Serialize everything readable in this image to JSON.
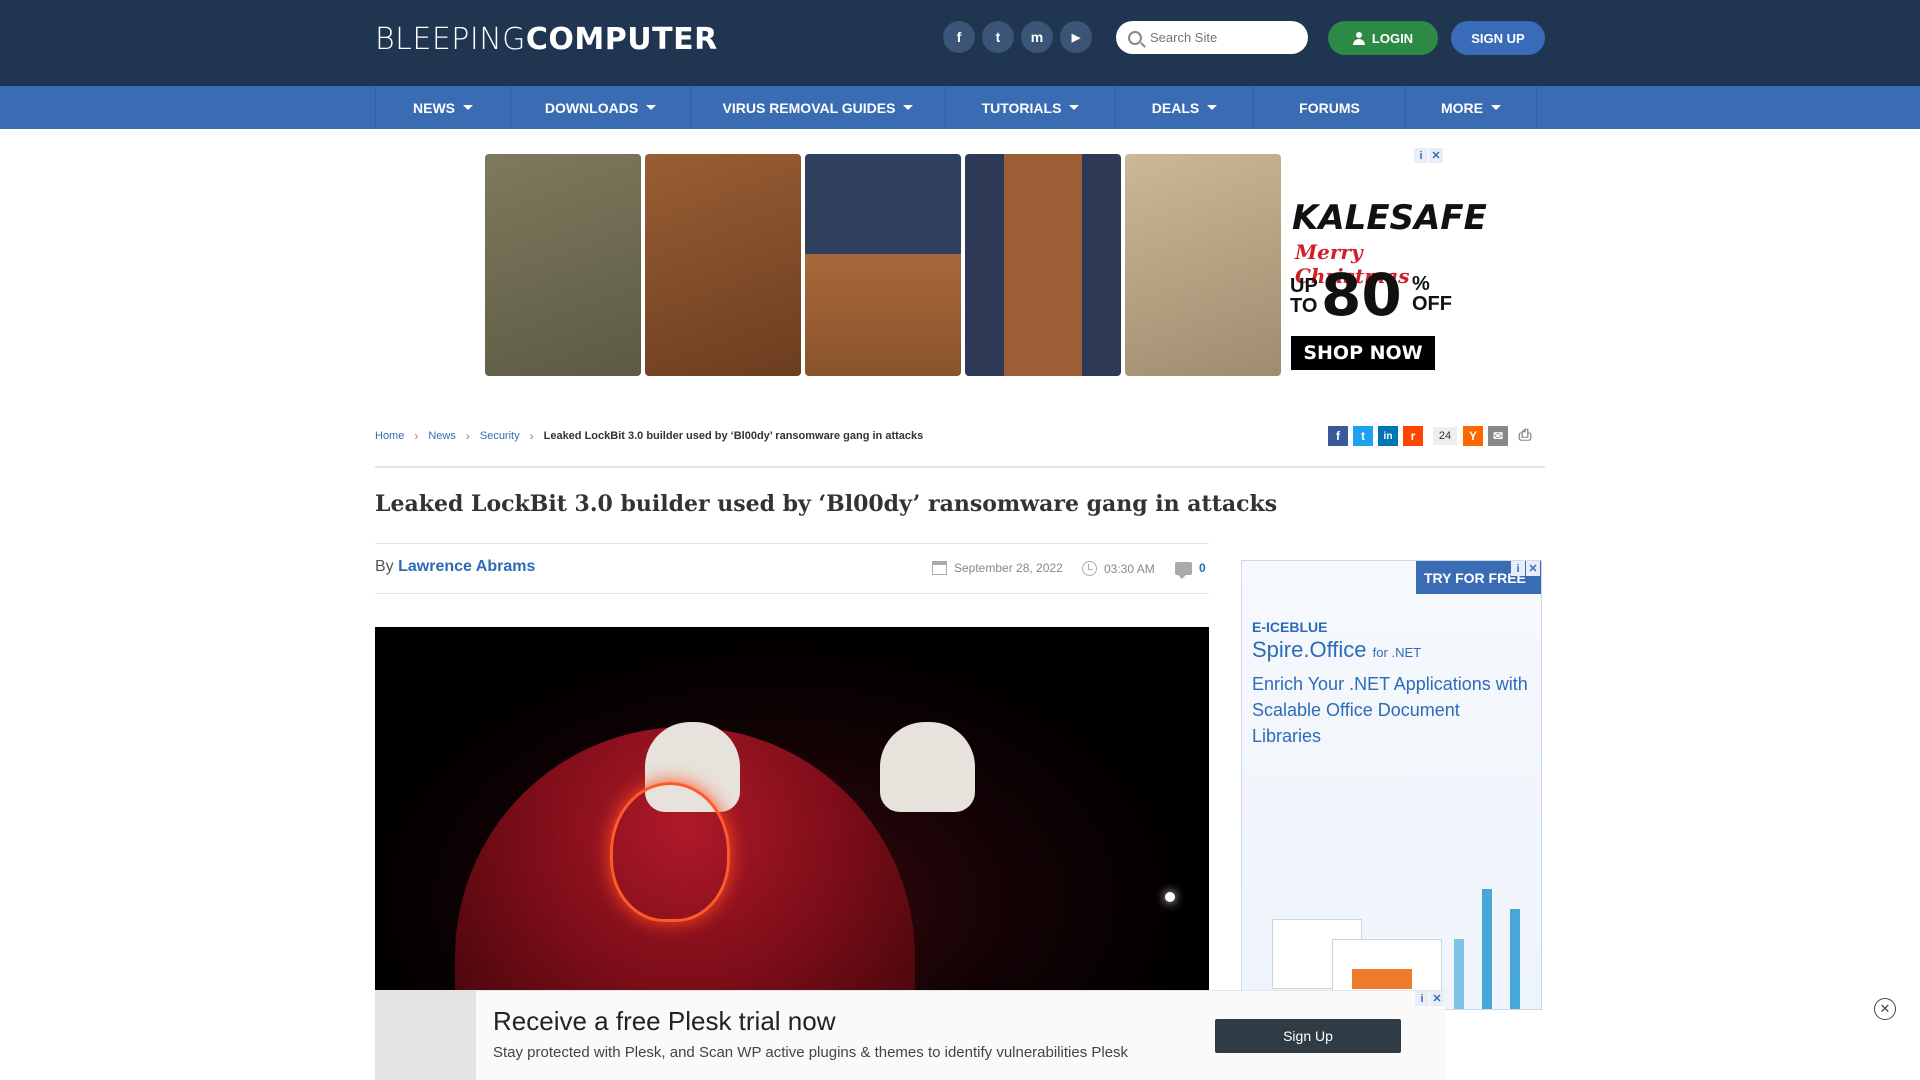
{
  "header": {
    "logo_light": "BLEEPING",
    "logo_bold": "COMPUTER",
    "social": [
      {
        "icon": "facebook-icon",
        "glyph": "f"
      },
      {
        "icon": "twitter-icon",
        "glyph": "t"
      },
      {
        "icon": "mastodon-icon",
        "glyph": "m"
      },
      {
        "icon": "youtube-icon",
        "glyph": "▶"
      }
    ],
    "search_placeholder": "Search Site",
    "login_label": "LOGIN",
    "signup_label": "SIGN UP"
  },
  "nav": {
    "items": [
      {
        "label": "NEWS",
        "dropdown": true
      },
      {
        "label": "DOWNLOADS",
        "dropdown": true
      },
      {
        "label": "VIRUS REMOVAL GUIDES",
        "dropdown": true
      },
      {
        "label": "TUTORIALS",
        "dropdown": true
      },
      {
        "label": "DEALS",
        "dropdown": true
      },
      {
        "label": "FORUMS",
        "dropdown": false
      },
      {
        "label": "MORE",
        "dropdown": true
      }
    ]
  },
  "top_ad": {
    "brand": "KALESAFE",
    "tagline": "Merry Christmas",
    "up_to": "UP TO",
    "discount": "80",
    "percent_off": "% OFF",
    "cta": "SHOP NOW"
  },
  "breadcrumb": {
    "home": "Home",
    "news": "News",
    "security": "Security",
    "current": "Leaked LockBit 3.0 builder used by ‘Bl00dy’ ransomware gang in attacks"
  },
  "share": {
    "count": "24",
    "buttons": [
      "facebook-share-icon",
      "twitter-share-icon",
      "linkedin-share-icon",
      "reddit-share-icon",
      "hackernews-share-icon",
      "email-share-icon",
      "print-icon"
    ]
  },
  "article": {
    "title": "Leaked LockBit 3.0 builder used by ‘Bl00dy’ ransomware gang in attacks",
    "by": "By",
    "author": "Lawrence Abrams",
    "date": "September 28, 2022",
    "time": "03:30 AM",
    "comments": "0"
  },
  "side_ad": {
    "try_free": "TRY FOR FREE",
    "brand": "E-ICEBLUE",
    "product": "Spire.Office",
    "product_suffix": "for .NET",
    "text": "Enrich Your .NET Applications with Scalable Office Document Libraries"
  },
  "bottom_ad": {
    "title": "Receive a free Plesk trial now",
    "subtitle": "Stay protected with Plesk, and Scan WP active plugins & themes to identify vulnerabilities Plesk",
    "cta": "Sign Up"
  },
  "colors": {
    "header_bg": "#1f3550",
    "nav_bg": "#3a6cb4",
    "login_green": "#2d8a46",
    "signup_blue": "#3a6bb8",
    "link_blue": "#2b6bb8"
  }
}
